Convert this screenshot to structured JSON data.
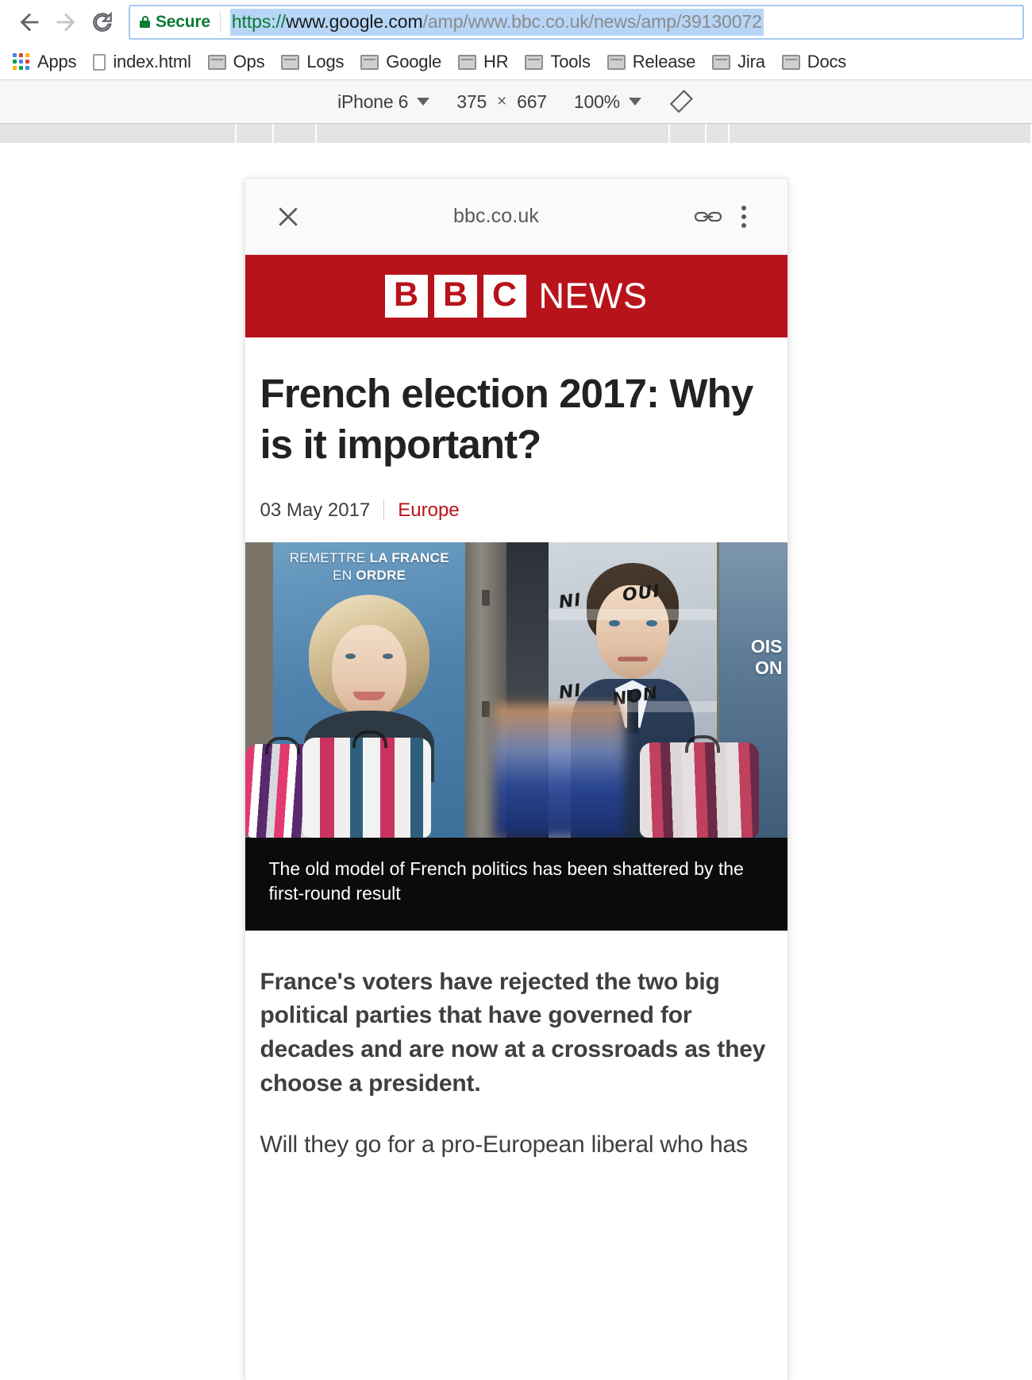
{
  "browser": {
    "nav": {
      "back_icon": "arrow-left-icon",
      "forward_icon": "arrow-right-icon",
      "reload_icon": "reload-icon"
    },
    "omnibox": {
      "security_label": "Secure",
      "lock_icon": "lock-icon",
      "url_scheme": "https://",
      "url_host": "www.google.com",
      "url_path": "/amp/www.bbc.co.uk/news/amp/39130072",
      "url_full": "https://www.google.com/amp/www.bbc.co.uk/news/amp/39130072"
    },
    "bookmarks": [
      {
        "label": "Apps",
        "icon": "apps-grid-icon"
      },
      {
        "label": "index.html",
        "icon": "document-icon"
      },
      {
        "label": "Ops",
        "icon": "folder-icon"
      },
      {
        "label": "Logs",
        "icon": "folder-icon"
      },
      {
        "label": "Google",
        "icon": "folder-icon"
      },
      {
        "label": "HR",
        "icon": "folder-icon"
      },
      {
        "label": "Tools",
        "icon": "folder-icon"
      },
      {
        "label": "Release",
        "icon": "folder-icon"
      },
      {
        "label": "Jira",
        "icon": "folder-icon"
      },
      {
        "label": "Docs",
        "icon": "folder-icon"
      }
    ]
  },
  "device_toolbar": {
    "device": "iPhone 6",
    "width": "375",
    "separator": "×",
    "height": "667",
    "zoom": "100%",
    "rotate_icon": "rotate-device-icon"
  },
  "amp_viewer": {
    "close_icon": "close-icon",
    "domain": "bbc.co.uk",
    "link_icon": "link-icon",
    "menu_icon": "kebab-menu-icon"
  },
  "bbc": {
    "logo_blocks": [
      "B",
      "B",
      "C"
    ],
    "logo_word": "NEWS",
    "brand_red": "#b8131b"
  },
  "article": {
    "headline": "French election 2017: Why is it important?",
    "date": "03 May 2017",
    "section": "Europe",
    "photo": {
      "lepen_poster_line1_plain": "REMETTRE ",
      "lepen_poster_line1_bold": "LA FRANCE",
      "lepen_poster_line2_plain": "EN ",
      "lepen_poster_line2_bold": "ORDRE",
      "graffiti_ni": "NI",
      "graffiti_oui": "OUI",
      "graffiti_ni2": "NI",
      "graffiti_non": "NON",
      "right_edge_line1": "OIS",
      "right_edge_line2": "ON"
    },
    "caption": "The old model of French politics has been shattered by the first-round result",
    "intro": "France's voters have rejected the two big political parties that have governed for decades and are now at a crossroads as they choose a president.",
    "paragraph_1": "Will they go for a pro-European liberal who has"
  }
}
